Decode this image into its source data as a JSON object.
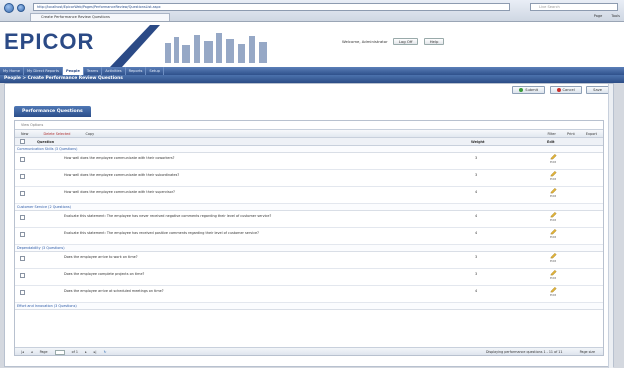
{
  "browser": {
    "address": "http://localhost/EpicorWeb/Pages/PerformanceReview/QuestionsList.aspx",
    "tab_title": "Create Performance Review Questions",
    "search_placeholder": "Live Search",
    "tools": [
      "Page",
      "Tools"
    ]
  },
  "header": {
    "logo": "EPICOR",
    "welcome": "Welcome, Administrator",
    "logout_label": "Log Off",
    "help_label": "Help",
    "nav_items": [
      "My Home",
      "My Direct Reports",
      "People",
      "Teams",
      "Activities",
      "Reports",
      "Setup"
    ],
    "active_nav": "People"
  },
  "breadcrumb": "People > Create Performance Review Questions",
  "actions": {
    "submit": "Submit",
    "cancel": "Cancel",
    "save": "Save"
  },
  "panel": {
    "title": "Performance Questions",
    "view_options": "View Options",
    "toolbar": {
      "new": "New",
      "delete": "Delete Selected",
      "copy": "Copy",
      "filter": "Filter",
      "print": "Print",
      "export": "Export"
    },
    "columns": {
      "check": "",
      "question": "Question",
      "weight": "Weight",
      "edit": "Edit"
    },
    "edit_label": "Edit",
    "groups": [
      {
        "name": "Communication Skills (3 Questions)",
        "rows": [
          {
            "question": "How well does the employee communicate with their coworkers?",
            "weight": "3"
          },
          {
            "question": "How well does the employee communicate with their subordinates?",
            "weight": "3"
          },
          {
            "question": "How well does the employee communicate with their supervisor?",
            "weight": "4"
          }
        ]
      },
      {
        "name": "Customer Service (2 Questions)",
        "rows": [
          {
            "question": "Evaluate this statement: The employee has never received negative comments regarding their level of customer service?",
            "weight": "4"
          },
          {
            "question": "Evaluate this statement: The employee has received positive comments regarding their level of customer service?",
            "weight": "4"
          }
        ]
      },
      {
        "name": "Dependability (3 Questions)",
        "rows": [
          {
            "question": "Does the employee arrive to work on time?",
            "weight": "3"
          },
          {
            "question": "Does the employee complete projects on time?",
            "weight": "3"
          },
          {
            "question": "Does the employee arrive at scheduled meetings on time?",
            "weight": "4"
          }
        ]
      },
      {
        "name": "Effort and Innovation (3 Questions)",
        "rows": []
      }
    ],
    "pager": {
      "page_label": "Page",
      "page_value": "1",
      "of_label": "of 1",
      "status": "Displaying performance questions 1 - 11 of 11",
      "per_page": "Page size"
    }
  }
}
